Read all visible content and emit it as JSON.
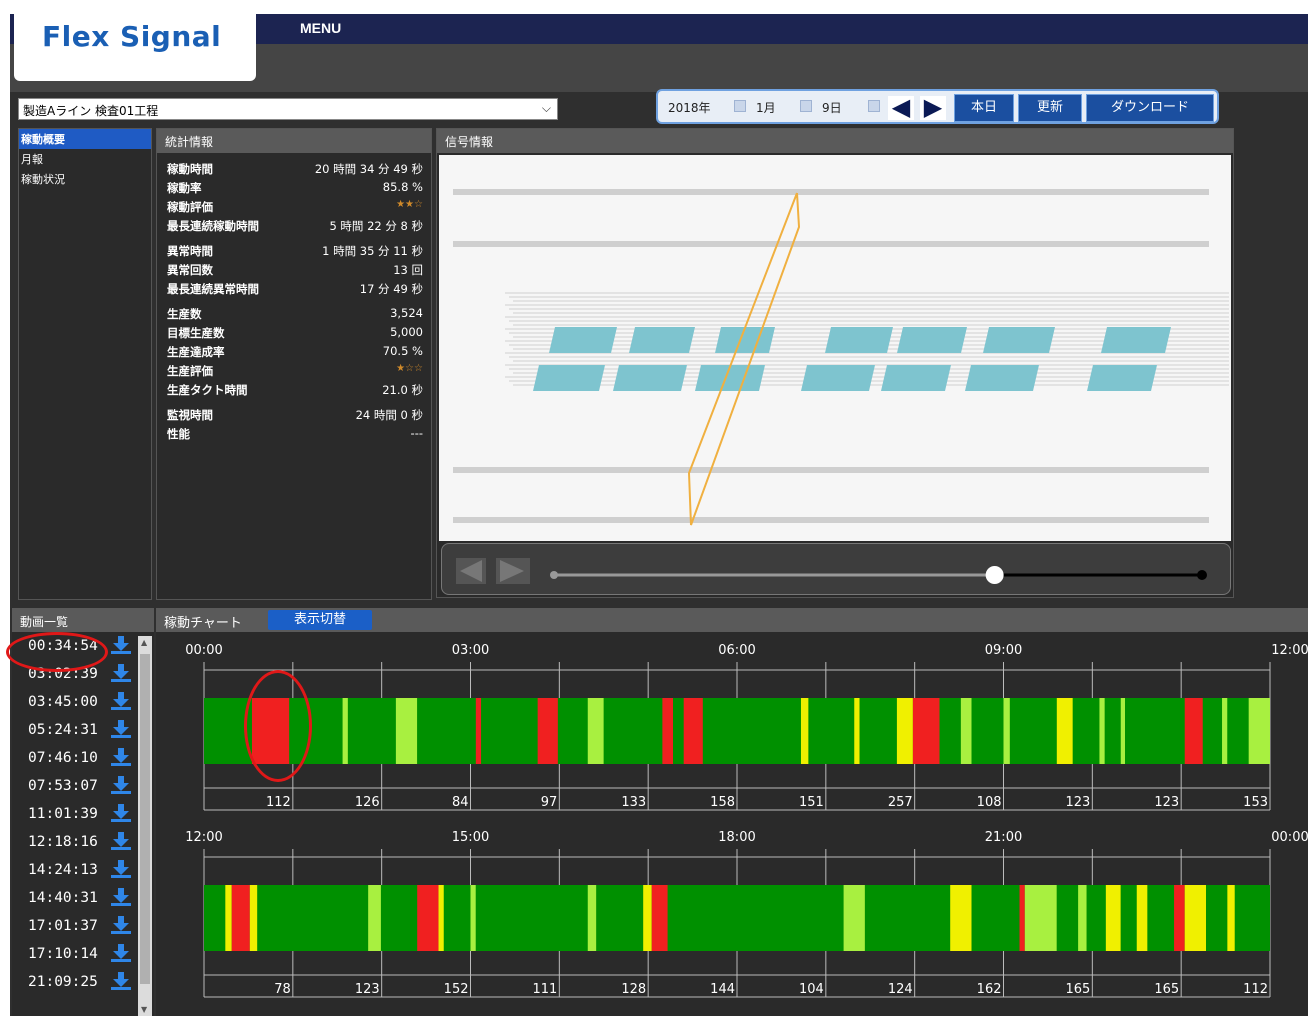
{
  "app": {
    "logo": "Flex Signal",
    "menu_label": "MENU"
  },
  "line_select": {
    "value": "製造Aライン 検査01工程"
  },
  "date_bar": {
    "year": "2018年",
    "month": "1月",
    "day": "9日",
    "prev_icon": "triangle-left-icon",
    "next_icon": "triangle-right-icon",
    "today_label": "本日",
    "refresh_label": "更新",
    "download_label": "ダウンロード"
  },
  "nav": {
    "items": [
      {
        "label": "稼動概要",
        "active": true
      },
      {
        "label": "月報",
        "active": false
      },
      {
        "label": "稼動状況",
        "active": false
      }
    ]
  },
  "stats": {
    "title": "統計情報",
    "rows": [
      {
        "key": "稼動時間",
        "value": "20 時間 34 分 49 秒"
      },
      {
        "key": "稼動率",
        "value": "85.8 %"
      },
      {
        "key": "稼動評価",
        "value": "★★☆"
      },
      {
        "key": "最長連続稼動時間",
        "value": "5 時間 22 分 8 秒"
      },
      {
        "key": "異常時間",
        "value": "1 時間 35 分 11 秒"
      },
      {
        "key": "異常回数",
        "value": "13 回"
      },
      {
        "key": "最長連続異常時間",
        "value": "17 分 49 秒"
      },
      {
        "key": "生産数",
        "value": "3,524"
      },
      {
        "key": "目標生産数",
        "value": "5,000"
      },
      {
        "key": "生産達成率",
        "value": "70.5 %"
      },
      {
        "key": "生産評価",
        "value": "★☆☆"
      },
      {
        "key": "生産タクト時間",
        "value": "21.0 秒"
      },
      {
        "key": "監視時間",
        "value": "24 時間 0 秒"
      },
      {
        "key": "性能",
        "value": "---"
      }
    ]
  },
  "signal": {
    "title": "信号情報",
    "slider_position": 0.68
  },
  "video_list": {
    "title": "動画一覧",
    "items": [
      "00:34:54",
      "03:02:39",
      "03:45:00",
      "05:24:31",
      "07:46:10",
      "07:53:07",
      "11:01:39",
      "12:18:16",
      "14:24:13",
      "14:40:31",
      "17:01:37",
      "17:10:14",
      "21:09:25"
    ],
    "download_icon": "download-icon"
  },
  "chart_panel": {
    "title": "稼動チャート",
    "toggle_label": "表示切替"
  },
  "chart_data": [
    {
      "type": "timeline",
      "x_labels": [
        "00:00",
        "03:00",
        "06:00",
        "09:00",
        "12:00"
      ],
      "counts": [
        "112",
        "126",
        "84",
        "97",
        "133",
        "158",
        "151",
        "257",
        "108",
        "123",
        "123",
        "153"
      ],
      "segments": [
        {
          "start": 0.0,
          "end": 0.045,
          "state": "run"
        },
        {
          "start": 0.045,
          "end": 0.08,
          "state": "stop"
        },
        {
          "start": 0.08,
          "end": 0.13,
          "state": "run"
        },
        {
          "start": 0.13,
          "end": 0.135,
          "state": "idle"
        },
        {
          "start": 0.135,
          "end": 0.18,
          "state": "run"
        },
        {
          "start": 0.18,
          "end": 0.2,
          "state": "idle"
        },
        {
          "start": 0.2,
          "end": 0.255,
          "state": "run"
        },
        {
          "start": 0.255,
          "end": 0.26,
          "state": "stop"
        },
        {
          "start": 0.26,
          "end": 0.313,
          "state": "run"
        },
        {
          "start": 0.313,
          "end": 0.332,
          "state": "stop"
        },
        {
          "start": 0.332,
          "end": 0.36,
          "state": "run"
        },
        {
          "start": 0.36,
          "end": 0.375,
          "state": "idle"
        },
        {
          "start": 0.375,
          "end": 0.43,
          "state": "run"
        },
        {
          "start": 0.43,
          "end": 0.44,
          "state": "stop"
        },
        {
          "start": 0.44,
          "end": 0.45,
          "state": "run"
        },
        {
          "start": 0.45,
          "end": 0.468,
          "state": "stop"
        },
        {
          "start": 0.468,
          "end": 0.56,
          "state": "run"
        },
        {
          "start": 0.56,
          "end": 0.567,
          "state": "warn"
        },
        {
          "start": 0.567,
          "end": 0.61,
          "state": "run"
        },
        {
          "start": 0.61,
          "end": 0.615,
          "state": "warn"
        },
        {
          "start": 0.615,
          "end": 0.65,
          "state": "run"
        },
        {
          "start": 0.65,
          "end": 0.665,
          "state": "warn"
        },
        {
          "start": 0.665,
          "end": 0.69,
          "state": "stop"
        },
        {
          "start": 0.69,
          "end": 0.71,
          "state": "run"
        },
        {
          "start": 0.71,
          "end": 0.72,
          "state": "idle"
        },
        {
          "start": 0.72,
          "end": 0.75,
          "state": "run"
        },
        {
          "start": 0.75,
          "end": 0.756,
          "state": "idle"
        },
        {
          "start": 0.756,
          "end": 0.8,
          "state": "run"
        },
        {
          "start": 0.8,
          "end": 0.815,
          "state": "warn"
        },
        {
          "start": 0.815,
          "end": 0.84,
          "state": "run"
        },
        {
          "start": 0.84,
          "end": 0.845,
          "state": "idle"
        },
        {
          "start": 0.845,
          "end": 0.86,
          "state": "run"
        },
        {
          "start": 0.86,
          "end": 0.864,
          "state": "idle"
        },
        {
          "start": 0.864,
          "end": 0.92,
          "state": "run"
        },
        {
          "start": 0.92,
          "end": 0.937,
          "state": "stop"
        },
        {
          "start": 0.937,
          "end": 0.955,
          "state": "run"
        },
        {
          "start": 0.955,
          "end": 0.96,
          "state": "idle"
        },
        {
          "start": 0.96,
          "end": 0.98,
          "state": "run"
        },
        {
          "start": 0.98,
          "end": 1.0,
          "state": "idle"
        }
      ]
    },
    {
      "type": "timeline",
      "x_labels": [
        "12:00",
        "15:00",
        "18:00",
        "21:00",
        "00:00"
      ],
      "counts": [
        "78",
        "123",
        "152",
        "111",
        "128",
        "144",
        "104",
        "124",
        "162",
        "165",
        "165",
        "112"
      ],
      "segments": [
        {
          "start": 0.0,
          "end": 0.02,
          "state": "run"
        },
        {
          "start": 0.02,
          "end": 0.026,
          "state": "warn"
        },
        {
          "start": 0.026,
          "end": 0.043,
          "state": "stop"
        },
        {
          "start": 0.043,
          "end": 0.05,
          "state": "warn"
        },
        {
          "start": 0.05,
          "end": 0.154,
          "state": "run"
        },
        {
          "start": 0.154,
          "end": 0.166,
          "state": "idle"
        },
        {
          "start": 0.166,
          "end": 0.2,
          "state": "run"
        },
        {
          "start": 0.2,
          "end": 0.22,
          "state": "stop"
        },
        {
          "start": 0.22,
          "end": 0.225,
          "state": "warn"
        },
        {
          "start": 0.225,
          "end": 0.25,
          "state": "run"
        },
        {
          "start": 0.25,
          "end": 0.255,
          "state": "idle"
        },
        {
          "start": 0.255,
          "end": 0.36,
          "state": "run"
        },
        {
          "start": 0.36,
          "end": 0.368,
          "state": "idle"
        },
        {
          "start": 0.368,
          "end": 0.412,
          "state": "run"
        },
        {
          "start": 0.412,
          "end": 0.42,
          "state": "warn"
        },
        {
          "start": 0.42,
          "end": 0.435,
          "state": "stop"
        },
        {
          "start": 0.435,
          "end": 0.6,
          "state": "run"
        },
        {
          "start": 0.6,
          "end": 0.62,
          "state": "idle"
        },
        {
          "start": 0.62,
          "end": 0.7,
          "state": "run"
        },
        {
          "start": 0.7,
          "end": 0.72,
          "state": "warn"
        },
        {
          "start": 0.72,
          "end": 0.765,
          "state": "run"
        },
        {
          "start": 0.765,
          "end": 0.77,
          "state": "stop"
        },
        {
          "start": 0.77,
          "end": 0.8,
          "state": "idle"
        },
        {
          "start": 0.8,
          "end": 0.82,
          "state": "run"
        },
        {
          "start": 0.82,
          "end": 0.828,
          "state": "idle"
        },
        {
          "start": 0.828,
          "end": 0.846,
          "state": "run"
        },
        {
          "start": 0.846,
          "end": 0.86,
          "state": "warn"
        },
        {
          "start": 0.86,
          "end": 0.875,
          "state": "run"
        },
        {
          "start": 0.875,
          "end": 0.885,
          "state": "warn"
        },
        {
          "start": 0.885,
          "end": 0.91,
          "state": "run"
        },
        {
          "start": 0.91,
          "end": 0.92,
          "state": "stop"
        },
        {
          "start": 0.92,
          "end": 0.94,
          "state": "warn"
        },
        {
          "start": 0.94,
          "end": 0.96,
          "state": "run"
        },
        {
          "start": 0.96,
          "end": 0.967,
          "state": "warn"
        },
        {
          "start": 0.967,
          "end": 1.0,
          "state": "run"
        }
      ]
    }
  ],
  "colors": {
    "run": "#009000",
    "idle": "#a8f040",
    "warn": "#f0f000",
    "stop": "#f02020",
    "header_blue": "#1c2451",
    "accent_blue": "#1b5fc7"
  }
}
